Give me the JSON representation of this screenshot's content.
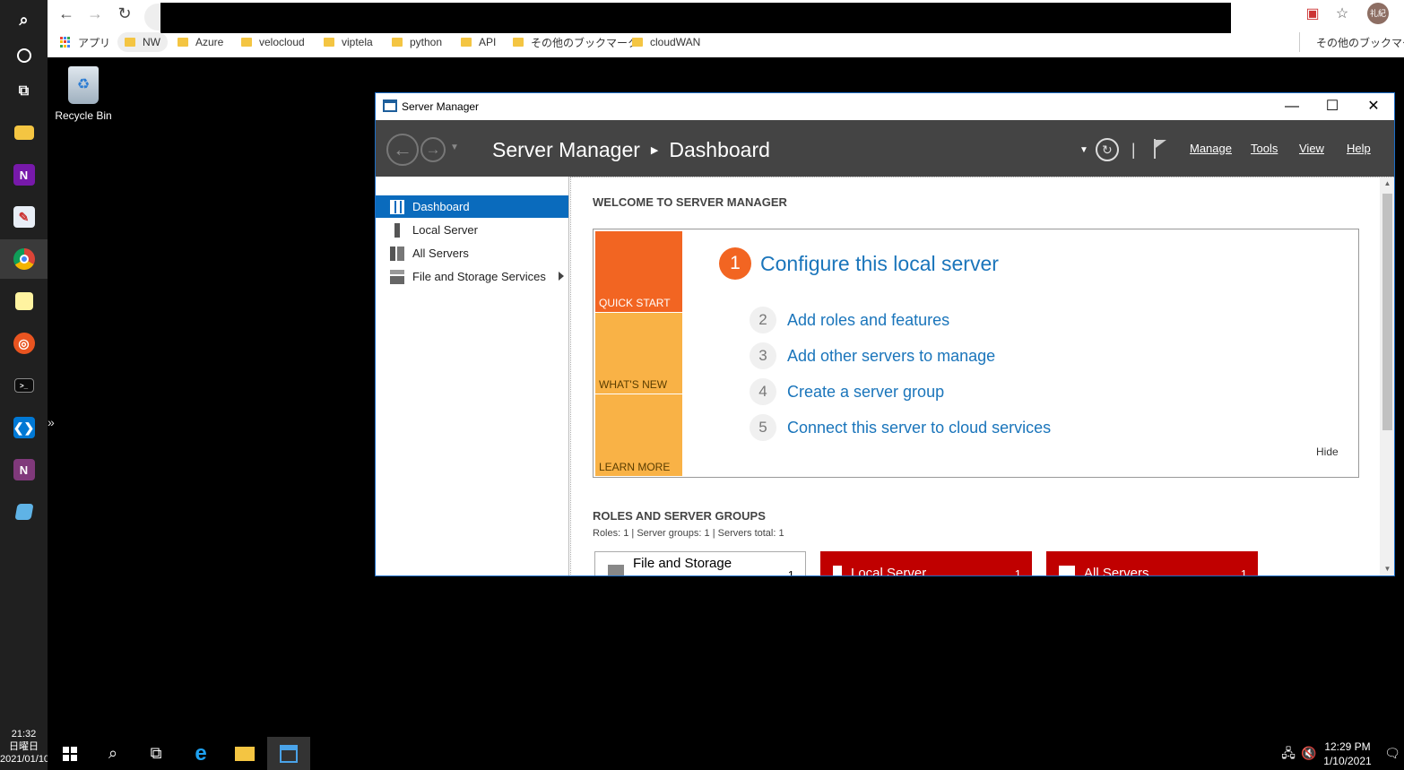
{
  "host": {
    "dock": {
      "items": [
        {
          "icon": "search-icon"
        },
        {
          "icon": "cortana-icon"
        },
        {
          "icon": "task-view-icon"
        },
        {
          "icon": "file-explorer-icon"
        },
        {
          "icon": "onenote-icon",
          "glyph": "N"
        },
        {
          "icon": "paint-icon"
        },
        {
          "icon": "chrome-icon"
        },
        {
          "icon": "sticky-notes-icon"
        },
        {
          "icon": "ubuntu-icon"
        },
        {
          "icon": "terminal-icon"
        },
        {
          "icon": "vscode-icon"
        },
        {
          "icon": "onenote-2016-icon",
          "glyph": "N"
        },
        {
          "icon": "notepad-icon"
        }
      ],
      "clock_time": "21:32",
      "clock_day": "日曜日",
      "clock_date": "2021/01/10"
    }
  },
  "browser": {
    "bookmarks": [
      {
        "label": "アプリ",
        "kind": "apps"
      },
      {
        "label": "NW",
        "kind": "folder"
      },
      {
        "label": "Azure",
        "kind": "folder"
      },
      {
        "label": "velocloud",
        "kind": "folder"
      },
      {
        "label": "viptela",
        "kind": "folder"
      },
      {
        "label": "python",
        "kind": "folder"
      },
      {
        "label": "API",
        "kind": "folder"
      },
      {
        "label": "その他のブックマーク",
        "kind": "folder"
      },
      {
        "label": "cloudWAN",
        "kind": "folder"
      }
    ],
    "other_bookmarks": "その他のブックマーク",
    "avatar_text": "礼紀"
  },
  "desktop": {
    "recycle_bin_label": "Recycle Bin"
  },
  "server_manager": {
    "window_title": "Server Manager",
    "breadcrumb_app": "Server Manager",
    "breadcrumb_page": "Dashboard",
    "menus": {
      "manage": "Manage",
      "tools": "Tools",
      "view": "View",
      "help": "Help"
    },
    "nav": {
      "dashboard": "Dashboard",
      "local_server": "Local Server",
      "all_servers": "All Servers",
      "file_storage": "File and Storage Services"
    },
    "welcome": {
      "title": "WELCOME TO SERVER MANAGER",
      "tiles": {
        "quick_start": "QUICK START",
        "whats_new": "WHAT'S NEW",
        "learn_more": "LEARN MORE"
      },
      "main_step_num": "1",
      "main_step": "Configure this local server",
      "steps": [
        {
          "num": "2",
          "label": "Add roles and features"
        },
        {
          "num": "3",
          "label": "Add other servers to manage"
        },
        {
          "num": "4",
          "label": "Create a server group"
        },
        {
          "num": "5",
          "label": "Connect this server to cloud services"
        }
      ],
      "hide": "Hide"
    },
    "roles": {
      "title": "ROLES AND SERVER GROUPS",
      "stats": "Roles: 1   |   Server groups: 1   |   Servers total: 1",
      "cards": [
        {
          "label": "File and Storage",
          "count": "1",
          "status_color": "#ffffff"
        },
        {
          "label": "Local Server",
          "count": "1",
          "status_color": "#c00000"
        },
        {
          "label": "All Servers",
          "count": "1",
          "status_color": "#c00000"
        }
      ]
    },
    "accent_color": "#0a6bbd"
  },
  "taskbar": {
    "clock_time": "12:29 PM",
    "clock_date": "1/10/2021",
    "items": [
      "start-button",
      "search-button",
      "task-view-button",
      "internet-explorer-icon",
      "file-explorer-icon",
      "server-manager-icon"
    ]
  }
}
